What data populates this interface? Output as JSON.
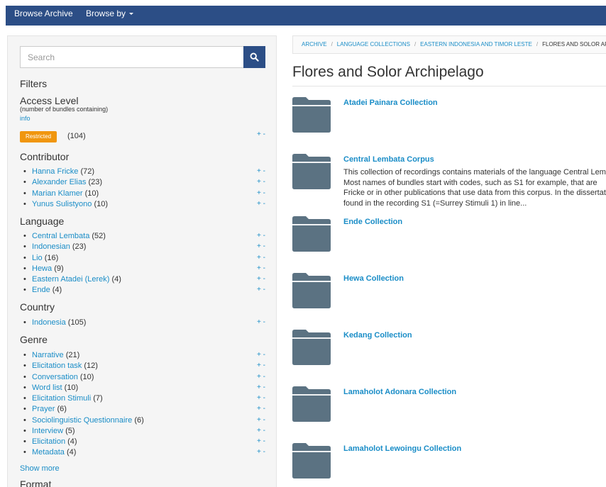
{
  "topbar": {
    "browse_archive": "Browse Archive",
    "browse_by": "Browse by"
  },
  "search": {
    "placeholder": "Search"
  },
  "filters": {
    "title": "Filters",
    "access_level": {
      "title": "Access Level",
      "subtitle": "(number of bundles containing)",
      "info": "info",
      "badge": "Restricted",
      "count": "(104)"
    },
    "plus_minus": "+ -",
    "contributor": {
      "title": "Contributor",
      "items": [
        {
          "name": "Hanna Fricke",
          "count": "(72)"
        },
        {
          "name": "Alexander Elias",
          "count": "(23)"
        },
        {
          "name": "Marian Klamer",
          "count": "(10)"
        },
        {
          "name": "Yunus Sulistyono",
          "count": "(10)"
        }
      ]
    },
    "language": {
      "title": "Language",
      "items": [
        {
          "name": "Central Lembata",
          "count": "(52)"
        },
        {
          "name": "Indonesian",
          "count": "(23)"
        },
        {
          "name": "Lio",
          "count": "(16)"
        },
        {
          "name": "Hewa",
          "count": "(9)"
        },
        {
          "name": "Eastern Atadei (Lerek)",
          "count": "(4)"
        },
        {
          "name": "Ende",
          "count": "(4)"
        }
      ]
    },
    "country": {
      "title": "Country",
      "items": [
        {
          "name": "Indonesia",
          "count": "(105)"
        }
      ]
    },
    "genre": {
      "title": "Genre",
      "items": [
        {
          "name": "Narrative",
          "count": "(21)"
        },
        {
          "name": "Elicitation task",
          "count": "(12)"
        },
        {
          "name": "Conversation",
          "count": "(10)"
        },
        {
          "name": "Word list",
          "count": "(10)"
        },
        {
          "name": "Elicitation Stimuli",
          "count": "(7)"
        },
        {
          "name": "Prayer",
          "count": "(6)"
        },
        {
          "name": "Sociolinguistic Questionnaire",
          "count": "(6)"
        },
        {
          "name": "Interview",
          "count": "(5)"
        },
        {
          "name": "Elicitation",
          "count": "(4)"
        },
        {
          "name": "Metadata",
          "count": "(4)"
        }
      ]
    },
    "show_more": "Show more",
    "format": {
      "title": "Format"
    }
  },
  "breadcrumb": [
    "ARCHIVE",
    "LANGUAGE COLLECTIONS",
    "EASTERN INDONESIA AND TIMOR LESTE",
    "FLORES AND SOLOR ARCHIPELAGO"
  ],
  "page_title": "Flores and Solor Archipelago",
  "collections": [
    {
      "title": "Atadei Painara Collection"
    },
    {
      "title": "Central Lembata Corpus",
      "desc": [
        "This collection of recordings contains materials of the language Central Lembata",
        "Most names of bundles start with codes, such as S1 for example, that are",
        "Fricke or in other publications that use data from this corpus. In the dissertation",
        "found in the recording S1 (=Surrey Stimuli 1) in line..."
      ]
    },
    {
      "title": "Ende Collection"
    },
    {
      "title": "Hewa Collection"
    },
    {
      "title": "Kedang Collection"
    },
    {
      "title": "Lamaholot Adonara Collection"
    },
    {
      "title": "Lamaholot Lewoingu Collection"
    }
  ],
  "colors": {
    "navbar": "#2c4e86",
    "link": "#1a8dc7",
    "badge": "#f0960e",
    "folder": "#5b7282"
  }
}
